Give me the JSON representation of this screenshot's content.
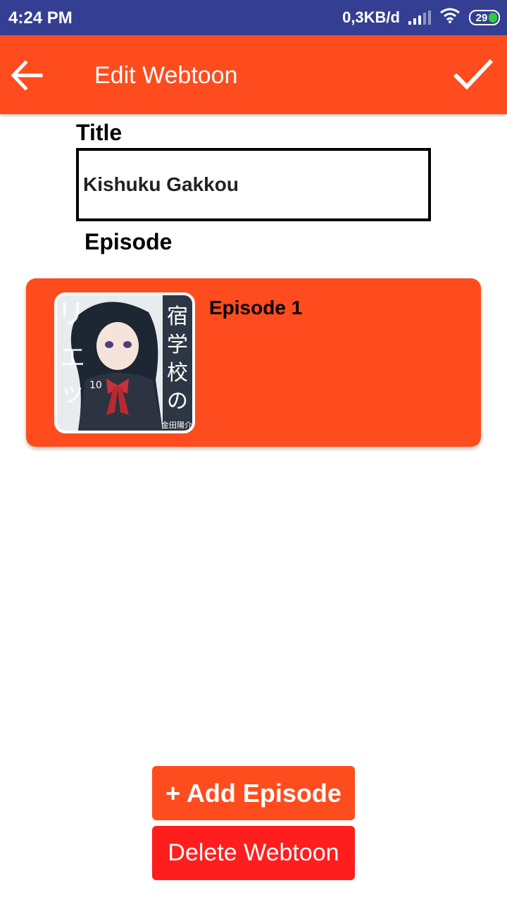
{
  "status_bar": {
    "time": "4:24 PM",
    "network_speed": "0,3KB/d",
    "battery_level": "29",
    "icons": [
      "signal-icon",
      "wifi-icon",
      "battery-icon"
    ]
  },
  "app_bar": {
    "title": "Edit Webtoon",
    "back_icon": "arrow-left-icon",
    "confirm_icon": "checkmark-icon"
  },
  "form": {
    "title_label": "Title",
    "title_value": "Kishuku Gakkou",
    "episode_label": "Episode"
  },
  "episodes": [
    {
      "name": "Episode 1",
      "thumbnail": "manga-cover-thumbnail"
    }
  ],
  "actions": {
    "add_episode_label": "+ Add Episode",
    "delete_webtoon_label": "Delete Webtoon"
  },
  "colors": {
    "status_bar": "#343f93",
    "accent": "#ff4c1e",
    "danger": "#ff1e1e",
    "battery_fill": "#2ecc40"
  }
}
